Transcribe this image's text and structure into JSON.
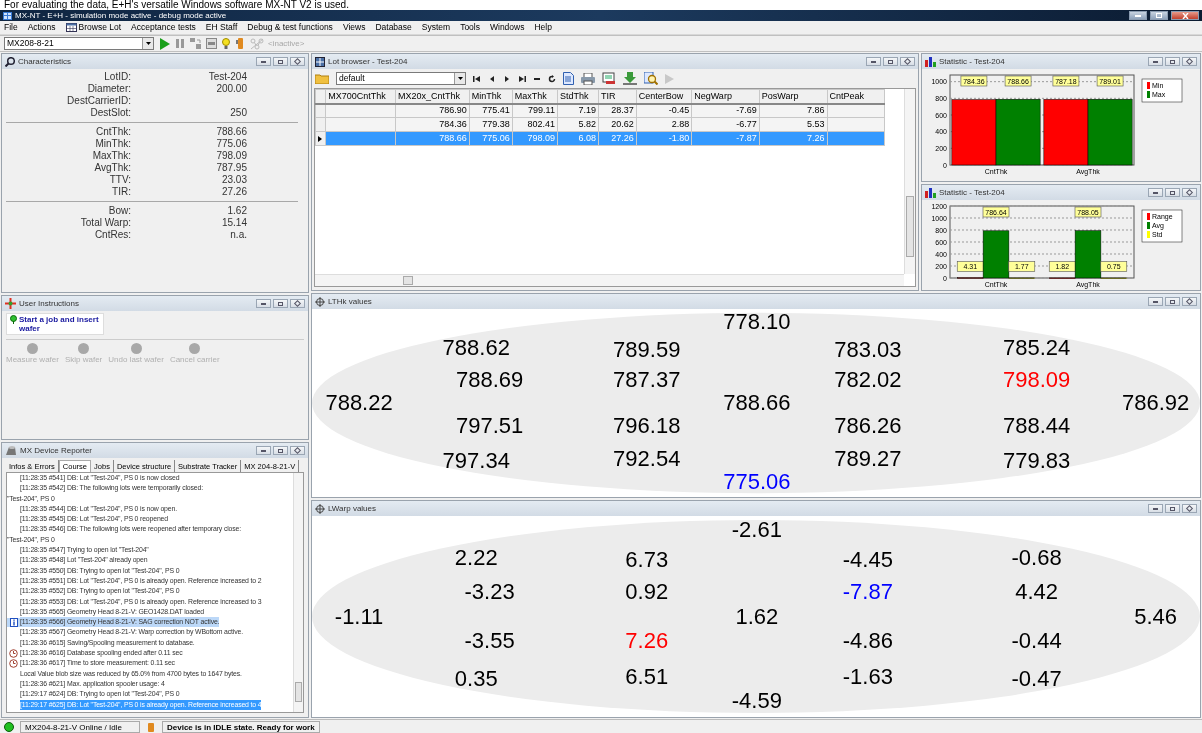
{
  "caption": "For evaluating the data, E+H's versatile Windows software MX-NT V2 is used.",
  "window": {
    "title": "MX-NT - E+H  - simulation mode active - debug mode active"
  },
  "menu": [
    {
      "label": "File",
      "kind": "plain"
    },
    {
      "label": "Actions",
      "kind": "plain"
    },
    {
      "label": "Browse Lot",
      "kind": "icon"
    },
    {
      "label": "Acceptance tests",
      "kind": "plain"
    },
    {
      "label": "EH Staff",
      "kind": "plain"
    },
    {
      "label": "Debug & test functions",
      "kind": "plain"
    },
    {
      "label": "Views",
      "kind": "plain"
    },
    {
      "label": "Database",
      "kind": "plain"
    },
    {
      "label": "System",
      "kind": "plain"
    },
    {
      "label": "Tools",
      "kind": "plain"
    },
    {
      "label": "Windows",
      "kind": "plain"
    },
    {
      "label": "Help",
      "kind": "plain"
    }
  ],
  "toolbar": {
    "device": "MX208-8-21",
    "inactive_label": "<inactive>"
  },
  "characteristics": {
    "title": "Characteristics",
    "groups": [
      [
        {
          "label": "LotID:",
          "value": "Test-204"
        },
        {
          "label": "Diameter:",
          "value": "200.00"
        },
        {
          "label": "DestCarrierID:"
        },
        {
          "label": "DestSlot:",
          "value": "250"
        }
      ],
      [
        {
          "label": "CntThk:",
          "value": "788.66"
        },
        {
          "label": "MinThk:",
          "value": "775.06"
        },
        {
          "label": "MaxThk:",
          "value": "798.09"
        },
        {
          "label": "AvgThk:",
          "value": "787.95"
        },
        {
          "label": "TTV:",
          "value": "23.03"
        },
        {
          "label": "TIR:",
          "value": "27.26"
        }
      ],
      [
        {
          "label": "Bow:",
          "value": "1.62"
        },
        {
          "label": "Total Warp:",
          "value": "15.14"
        },
        {
          "label": "CntRes:",
          "value": "n.a."
        }
      ]
    ]
  },
  "lot_browser": {
    "title": "Lot browser - Test-204",
    "view": "default",
    "columns": [
      "MX700CntThk",
      "MX20x_CntThk",
      "MinThk",
      "MaxThk",
      "StdThk",
      "TIR",
      "CenterBow",
      "NegWarp",
      "PosWarp",
      "CntPeak"
    ],
    "rows": [
      {
        "selected": false,
        "cells": [
          "",
          "786.90",
          "775.41",
          "799.11",
          "7.19",
          "28.37",
          "-0.45",
          "-7.69",
          "7.86"
        ]
      },
      {
        "selected": false,
        "cells": [
          "",
          "784.36",
          "779.38",
          "802.41",
          "5.82",
          "20.62",
          "2.88",
          "-6.77",
          "5.53"
        ]
      },
      {
        "selected": true,
        "cells": [
          "",
          "788.66",
          "775.06",
          "798.09",
          "6.08",
          "27.26",
          "-1.80",
          "-7.87",
          "7.26"
        ]
      }
    ]
  },
  "statistics": [
    {
      "title": "Statistic - Test-204",
      "chart_data": {
        "type": "bar",
        "categories": [
          "CntThk",
          "AvgThk"
        ],
        "series": [
          {
            "name": "Min",
            "color": "#ff0000",
            "values": [
              784.36,
              787.18
            ]
          },
          {
            "name": "Max",
            "color": "#008000",
            "values": [
              788.66,
              789.01
            ]
          }
        ],
        "ylim": [
          0,
          1080
        ],
        "yticks": [
          0,
          200,
          400,
          600,
          800,
          1000
        ],
        "grid": true,
        "legend": true,
        "data_labels": true
      }
    },
    {
      "title": "Statistic - Test-204",
      "chart_data": {
        "type": "bar",
        "categories": [
          "CntThk",
          "AvgThk"
        ],
        "series": [
          {
            "name": "Range",
            "color": "#ff0000",
            "values": [
              4.31,
              1.82
            ]
          },
          {
            "name": "Avg",
            "color": "#008000",
            "values": [
              786.64,
              788.05
            ]
          },
          {
            "name": "Std",
            "color": "#ffff00",
            "values": [
              1.77,
              0.75
            ]
          }
        ],
        "ylim": [
          0,
          1200
        ],
        "yticks": [
          0,
          200,
          400,
          600,
          800,
          1000,
          1200
        ],
        "grid": true,
        "legend": true,
        "data_labels": true
      }
    }
  ],
  "user_instructions": {
    "title": "User Instructions",
    "message": "Start a job and insert wafer",
    "actions": [
      {
        "label": "Measure wafer",
        "disabled": true
      },
      {
        "label": "Skip wafer",
        "disabled": true
      },
      {
        "label": "Undo last wafer",
        "disabled": true
      },
      {
        "label": "Cancel carrier",
        "disabled": true
      }
    ]
  },
  "device_reporter": {
    "title": "MX Device Reporter",
    "tabs": [
      {
        "label": "Infos & Errors",
        "selected": false
      },
      {
        "label": "Course",
        "selected": true
      },
      {
        "label": "Jobs",
        "selected": false
      },
      {
        "label": "Device structure",
        "selected": false
      },
      {
        "label": "Substrate Tracker",
        "selected": false
      },
      {
        "label": "MX 204-8-21-V",
        "selected": false
      }
    ],
    "log": [
      {
        "text": "[11:28:35 #541] DB: Lot \"Test-204\", PS 0 is now closed",
        "kind": "entry",
        "highlighted": false,
        "selected": false
      },
      {
        "text": "[11:28:35 #542] DB: The following lots were temporarily closed:",
        "kind": "entry",
        "highlighted": false,
        "selected": false
      },
      {
        "text": "\"Test-204\", PS 0",
        "kind": "wrap",
        "highlighted": false,
        "selected": false
      },
      {
        "text": "[11:28:35 #544] DB: Lot \"Test-204\", PS 0 is now open.",
        "kind": "entry",
        "highlighted": false,
        "selected": false
      },
      {
        "text": "[11:28:35 #545] DB: Lot \"Test-204\", PS 0 reopened",
        "kind": "entry",
        "highlighted": false,
        "selected": false
      },
      {
        "text": "[11:28:35 #546] DB: The following lots were reopened after temporary close:",
        "kind": "entry",
        "highlighted": false,
        "selected": false
      },
      {
        "text": "\"Test-204\", PS 0",
        "kind": "wrap",
        "highlighted": false,
        "selected": false
      },
      {
        "text": "[11:28:35 #547] Trying to open lot \"Test-204\"",
        "kind": "entry",
        "highlighted": false,
        "selected": false
      },
      {
        "text": "[11:28:35 #548] Lot \"Test-204\" already open",
        "kind": "entry",
        "highlighted": false,
        "selected": false
      },
      {
        "text": "[11:28:35 #550] DB: Trying to open lot \"Test-204\", PS 0",
        "kind": "entry",
        "highlighted": false,
        "selected": false
      },
      {
        "text": "[11:28:35 #551] DB: Lot \"Test-204\", PS 0 is already open. Reference increased to 2",
        "kind": "entry",
        "highlighted": false,
        "selected": false
      },
      {
        "text": "[11:28:35 #552] DB: Trying to open lot \"Test-204\", PS 0",
        "kind": "entry",
        "highlighted": false,
        "selected": false
      },
      {
        "text": "[11:28:35 #553] DB: Lot \"Test-204\", PS 0 is already open. Reference increased to 3",
        "kind": "entry",
        "highlighted": false,
        "selected": false
      },
      {
        "text": "[11:28:35 #565] Geometry Head 8-21-V: GEO1428.DAT loaded",
        "kind": "entry",
        "highlighted": false,
        "selected": false
      },
      {
        "text": "[11:28:35 #566] Geometry Head 8-21-V: SAG correction NOT active.",
        "kind": "info",
        "highlighted": true,
        "selected": false
      },
      {
        "text": "[11:28:35 #567] Geometry Head 8-21-V: Warp correction by WBottom active.",
        "kind": "entry",
        "highlighted": false,
        "selected": false
      },
      {
        "text": "[11:28:36 #615] Saving/Spooling measurement to database.",
        "kind": "entry",
        "highlighted": false,
        "selected": false
      },
      {
        "text": "[11:28:36 #616] Database spooling ended after 0.11 sec",
        "kind": "timer",
        "highlighted": false,
        "selected": false
      },
      {
        "text": "[11:28:36 #617] Time to store measurement: 0.11 sec",
        "kind": "timer",
        "highlighted": false,
        "selected": false
      },
      {
        "text": "Local Value blob size was reduced by  65.0% from 4700 bytes to 1647 bytes.",
        "kind": "entry",
        "highlighted": false,
        "selected": false
      },
      {
        "text": "[11:28:36 #621] Max. application spooler usage: 4",
        "kind": "entry",
        "highlighted": false,
        "selected": false
      },
      {
        "text": "[11:29:17 #624] DB: Trying to open lot \"Test-204\", PS 0",
        "kind": "entry",
        "highlighted": false,
        "selected": false
      },
      {
        "text": "[11:29:17 #625] DB: Lot \"Test-204\", PS 0 is already open. Reference increased to 4",
        "kind": "entry",
        "highlighted": false,
        "selected": true
      }
    ]
  },
  "maps": [
    {
      "title": "LTHk values",
      "values": [
        {
          "text": "778.10",
          "color": "#000000"
        },
        {
          "text": "788.62",
          "color": "#000000"
        },
        {
          "text": "789.59",
          "color": "#000000"
        },
        {
          "text": "783.03",
          "color": "#000000"
        },
        {
          "text": "785.24",
          "color": "#000000"
        },
        {
          "text": "788.69",
          "color": "#000000"
        },
        {
          "text": "787.37",
          "color": "#000000"
        },
        {
          "text": "782.02",
          "color": "#000000"
        },
        {
          "text": "798.09",
          "color": "#ff0000"
        },
        {
          "text": "788.22",
          "color": "#000000"
        },
        {
          "text": "788.66",
          "color": "#000000"
        },
        {
          "text": "786.92",
          "color": "#000000"
        },
        {
          "text": "797.51",
          "color": "#000000"
        },
        {
          "text": "796.18",
          "color": "#000000"
        },
        {
          "text": "786.26",
          "color": "#000000"
        },
        {
          "text": "788.44",
          "color": "#000000"
        },
        {
          "text": "797.34",
          "color": "#000000"
        },
        {
          "text": "792.54",
          "color": "#000000"
        },
        {
          "text": "789.27",
          "color": "#000000"
        },
        {
          "text": "779.83",
          "color": "#000000"
        },
        {
          "text": "775.06",
          "color": "#0000ff"
        }
      ]
    },
    {
      "title": "LWarp values",
      "values": [
        {
          "text": "-2.61",
          "color": "#000000"
        },
        {
          "text": "2.22",
          "color": "#000000"
        },
        {
          "text": "6.73",
          "color": "#000000"
        },
        {
          "text": "-4.45",
          "color": "#000000"
        },
        {
          "text": "-0.68",
          "color": "#000000"
        },
        {
          "text": "-3.23",
          "color": "#000000"
        },
        {
          "text": "0.92",
          "color": "#000000"
        },
        {
          "text": "-7.87",
          "color": "#0000ff"
        },
        {
          "text": "4.42",
          "color": "#000000"
        },
        {
          "text": "-1.11",
          "color": "#000000"
        },
        {
          "text": "1.62",
          "color": "#000000"
        },
        {
          "text": "5.46",
          "color": "#000000"
        },
        {
          "text": "-3.55",
          "color": "#000000"
        },
        {
          "text": "7.26",
          "color": "#ff0000"
        },
        {
          "text": "-4.86",
          "color": "#000000"
        },
        {
          "text": "-0.44",
          "color": "#000000"
        },
        {
          "text": "0.35",
          "color": "#000000"
        },
        {
          "text": "6.51",
          "color": "#000000"
        },
        {
          "text": "-1.63",
          "color": "#000000"
        },
        {
          "text": "-0.47",
          "color": "#000000"
        },
        {
          "text": "-4.59",
          "color": "#000000"
        }
      ]
    }
  ],
  "status_bar": {
    "connection": "MX204-8-21-V Online / Idle",
    "message": "Device is in IDLE state. Ready for work"
  }
}
